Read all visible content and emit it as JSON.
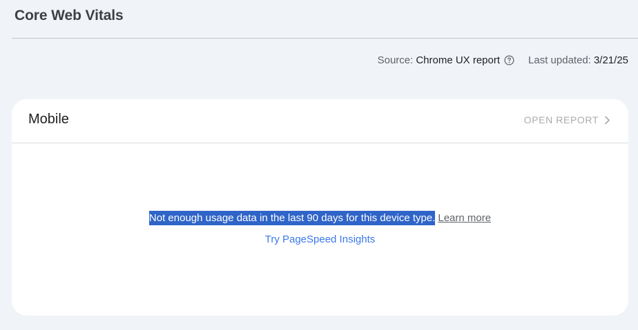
{
  "header": {
    "title": "Core Web Vitals"
  },
  "meta": {
    "source_label": "Source:",
    "source_value": "Chrome UX report",
    "help_icon": "question-circle-icon",
    "updated_label": "Last updated:",
    "updated_value": "3/21/25"
  },
  "card": {
    "title": "Mobile",
    "open_report_label": "OPEN REPORT",
    "open_report_icon": "chevron-right-icon",
    "message": "Not enough usage data in the last 90 days for this device type.",
    "learn_more": "Learn more",
    "psi_link": "Try PageSpeed Insights"
  },
  "colors": {
    "background": "#f0f4f9",
    "card": "#ffffff",
    "selection_highlight": "#2f64c8",
    "link_blue": "#3b78e7",
    "disabled_text": "#a8abaf"
  }
}
